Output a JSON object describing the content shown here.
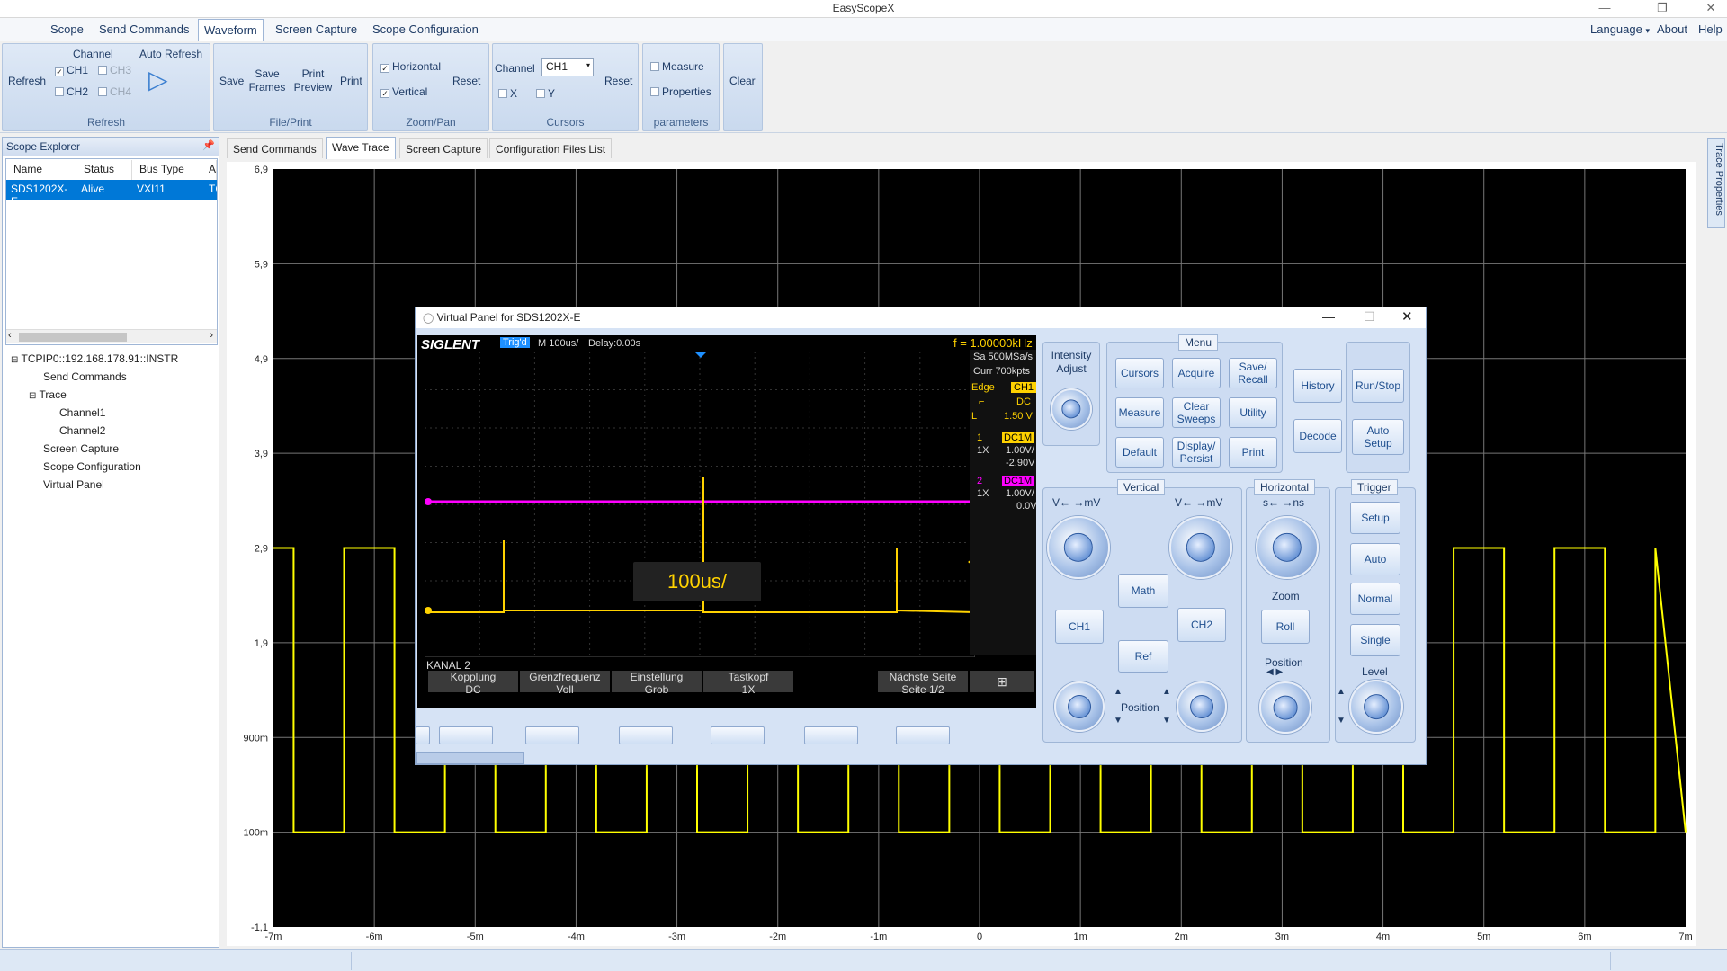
{
  "app": {
    "title": "EasyScopeX"
  },
  "menubar": {
    "items": [
      "Scope",
      "Send Commands",
      "Waveform",
      "Screen Capture",
      "Scope Configuration"
    ],
    "active": "Waveform",
    "right": [
      "Language",
      "About",
      "Help"
    ]
  },
  "ribbon": {
    "refresh": {
      "refresh": "Refresh",
      "channel": "Channel",
      "ch1": "CH1",
      "ch2": "CH2",
      "ch3": "CH3",
      "ch4": "CH4",
      "auto_refresh": "Auto Refresh",
      "label": "Refresh"
    },
    "fileprint": {
      "save": "Save",
      "save_frames": "Save Frames",
      "print_preview": "Print Preview",
      "print": "Print",
      "label": "File/Print"
    },
    "zoompan": {
      "horizontal": "Horizontal",
      "vertical": "Vertical",
      "reset": "Reset",
      "label": "Zoom/Pan"
    },
    "cursors": {
      "channel": "Channel",
      "channel_value": "CH1",
      "x": "X",
      "y": "Y",
      "reset": "Reset",
      "label": "Cursors"
    },
    "parameters": {
      "measure": "Measure",
      "properties": "Properties",
      "label": "parameters"
    },
    "clear": {
      "label": "Clear"
    }
  },
  "explorer": {
    "title": "Scope Explorer",
    "columns": [
      "Name",
      "Status",
      "Bus Type",
      "A"
    ],
    "row": [
      "SDS1202X-E",
      "Alive",
      "VXI11",
      "TC"
    ],
    "tree": [
      "TCPIP0::192.168.178.91::INSTR",
      "Send Commands",
      "Trace",
      "Channel1",
      "Channel2",
      "Screen Capture",
      "Scope Configuration",
      "Virtual Panel"
    ]
  },
  "tabs": [
    "Send Commands",
    "Wave Trace",
    "Screen Capture",
    "Configuration Files List"
  ],
  "active_tab": "Wave Trace",
  "side_tab": "Trace Properties",
  "chart_data": {
    "type": "line",
    "y_ticks": [
      "6,9",
      "5,9",
      "4,9",
      "3,9",
      "2,9",
      "1,9",
      "900m",
      "-100m",
      "-1,1"
    ],
    "x_ticks": [
      "-7m",
      "-6m",
      "-5m",
      "-4m",
      "-3m",
      "-2m",
      "-1m",
      "0",
      "1m",
      "2m",
      "3m",
      "4m",
      "5m",
      "6m",
      "7m"
    ],
    "xlim": [
      -0.007,
      0.007
    ],
    "ylim": [
      -1.1,
      6.9
    ],
    "series": [
      {
        "high": 2.9,
        "low": -0.1,
        "period": 0.001,
        "rising_edges": [
          -0.0073,
          -0.0063,
          -0.0053,
          -0.0043,
          -0.0033,
          -0.0023,
          -0.0013,
          -0.0003,
          0.0007,
          0.0017,
          0.0027,
          0.0037,
          0.0047,
          0.0057,
          0.0067
        ],
        "duty": 0.5,
        "color": "#ffff00"
      }
    ]
  },
  "vpanel": {
    "title": "Virtual Panel for SDS1202X-E",
    "brand": "SIGLENT",
    "trig": "Trig'd",
    "timebase": "M 100us/",
    "delay": "Delay:0.00s",
    "freq": "f = 1.00000kHz",
    "sa": "Sa 500MSa/s",
    "curr": "Curr 700kpts",
    "edge": "Edge",
    "edge_ch": "CH1",
    "dc": "DC",
    "level": "L",
    "level_val": "1.50 V",
    "ch1_num": "1",
    "ch1_cpl": "DC1M",
    "ch1_probe": "1X",
    "ch1_scale": "1.00V/",
    "ch1_off": "-2.90V",
    "ch2_num": "2",
    "ch2_cpl": "DC1M",
    "ch2_probe": "1X",
    "ch2_scale": "1.00V/",
    "ch2_off": "0.0V",
    "overlay": "100us/",
    "menu_title": "KANAL 2",
    "softkeys": [
      [
        "Kopplung",
        "DC"
      ],
      [
        "Grenzfrequenz",
        "Voll"
      ],
      [
        "Einstellung",
        "Grob"
      ],
      [
        "Tastkopf",
        "1X"
      ],
      [
        "Nächste Seite",
        "Seite 1/2"
      ]
    ],
    "intensity": "Intensity Adjust",
    "menu": "Menu",
    "menu_buttons": [
      "Cursors",
      "Acquire",
      "Save/ Recall",
      "Measure",
      "Clear Sweeps",
      "Utility",
      "Default",
      "Display/ Persist",
      "Print"
    ],
    "history": "History",
    "decode": "Decode",
    "run_stop": "Run/Stop",
    "auto_setup": "Auto Setup",
    "vertical": "Vertical",
    "v_mv_left": "V← →mV",
    "v_mv_right": "V← →mV",
    "math": "Math",
    "ch1": "CH1",
    "ch2": "CH2",
    "ref": "Ref",
    "position": "Position",
    "horizontal": "Horizontal",
    "s_ns": "s← →ns",
    "zoom": "Zoom",
    "roll": "Roll",
    "h_position": "Position",
    "trigger": "Trigger",
    "setup": "Setup",
    "auto": "Auto",
    "normal": "Normal",
    "single": "Single",
    "trig_level": "Level"
  }
}
